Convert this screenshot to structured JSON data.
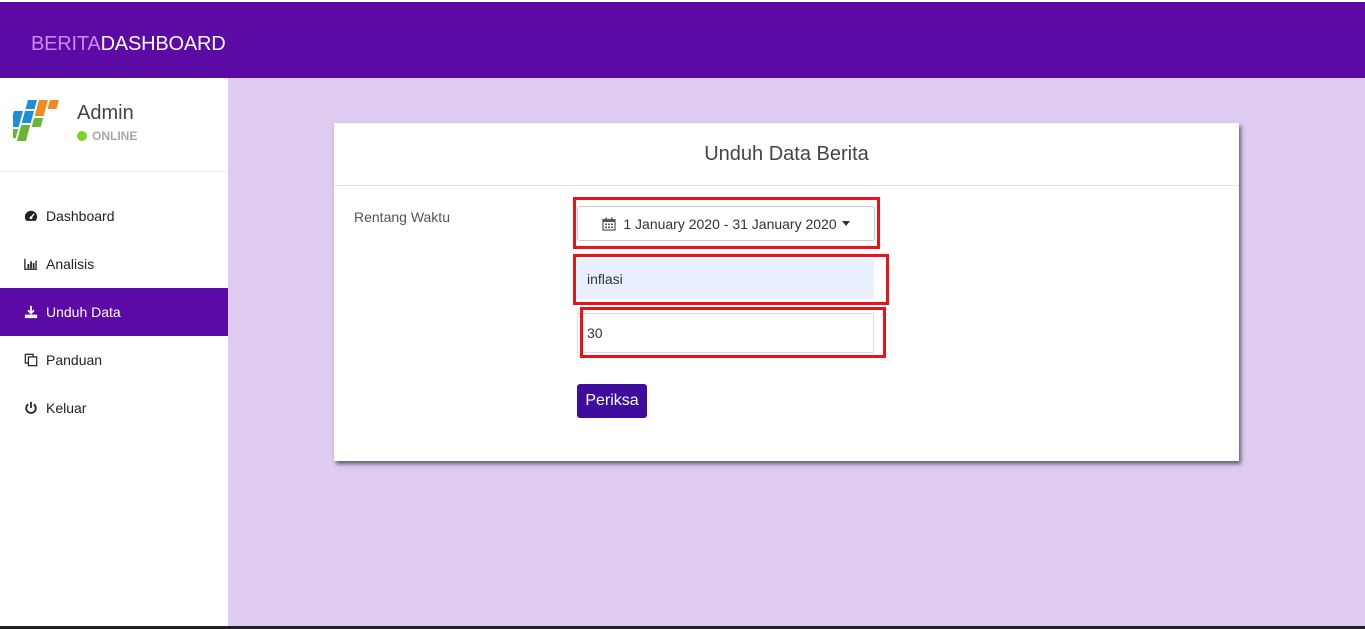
{
  "header": {
    "brand_part1": "BERITA",
    "brand_part2": "DASHBOARD",
    "bg_color": "#5b0aa5"
  },
  "user": {
    "name": "Admin",
    "status": "ONLINE",
    "status_color": "#7ed321"
  },
  "sidebar": {
    "items": [
      {
        "label": "Dashboard",
        "icon": "dashboard-icon",
        "active": false
      },
      {
        "label": "Analisis",
        "icon": "bar-chart-icon",
        "active": false
      },
      {
        "label": "Unduh Data",
        "icon": "download-icon",
        "active": true
      },
      {
        "label": "Panduan",
        "icon": "copy-icon",
        "active": false
      },
      {
        "label": "Keluar",
        "icon": "power-icon",
        "active": false
      }
    ]
  },
  "card": {
    "title": "Unduh Data Berita",
    "field_label": "Rentang Waktu",
    "date_range": "1 January 2020 - 31 January 2020",
    "keyword_value": "inflasi",
    "count_value": "30",
    "submit_label": "Periksa"
  },
  "colors": {
    "accent": "#5b0aa5",
    "button": "#3e0d9e",
    "background": "#ddccf0",
    "highlight": "#e8141b"
  }
}
